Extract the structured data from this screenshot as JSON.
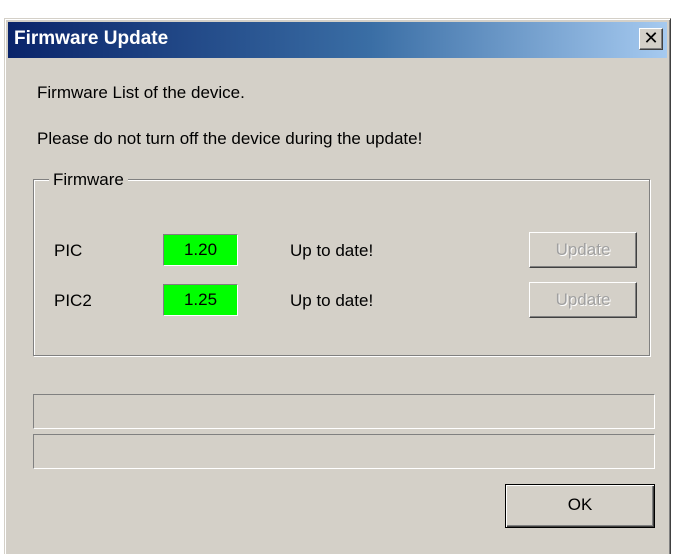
{
  "window": {
    "title": "Firmware Update",
    "close_glyph": "✕"
  },
  "messages": {
    "line1": "Firmware List of the device.",
    "line2": "Please do not turn off the device during the update!"
  },
  "firmware_group": {
    "label": "Firmware",
    "rows": [
      {
        "name": "PIC",
        "version": "1.20",
        "status": "Up to date!",
        "button_label": "Update",
        "button_enabled": false
      },
      {
        "name": "PIC2",
        "version": "1.25",
        "status": "Up to date!",
        "button_label": "Update",
        "button_enabled": false
      }
    ]
  },
  "progress": {
    "bar1": 0,
    "bar2": 0
  },
  "buttons": {
    "ok_label": "OK"
  },
  "colors": {
    "version_ok": "#00ff00",
    "dialog_face": "#d4d0c8",
    "titlebar_start": "#0a246a",
    "titlebar_end": "#a6caf0"
  }
}
